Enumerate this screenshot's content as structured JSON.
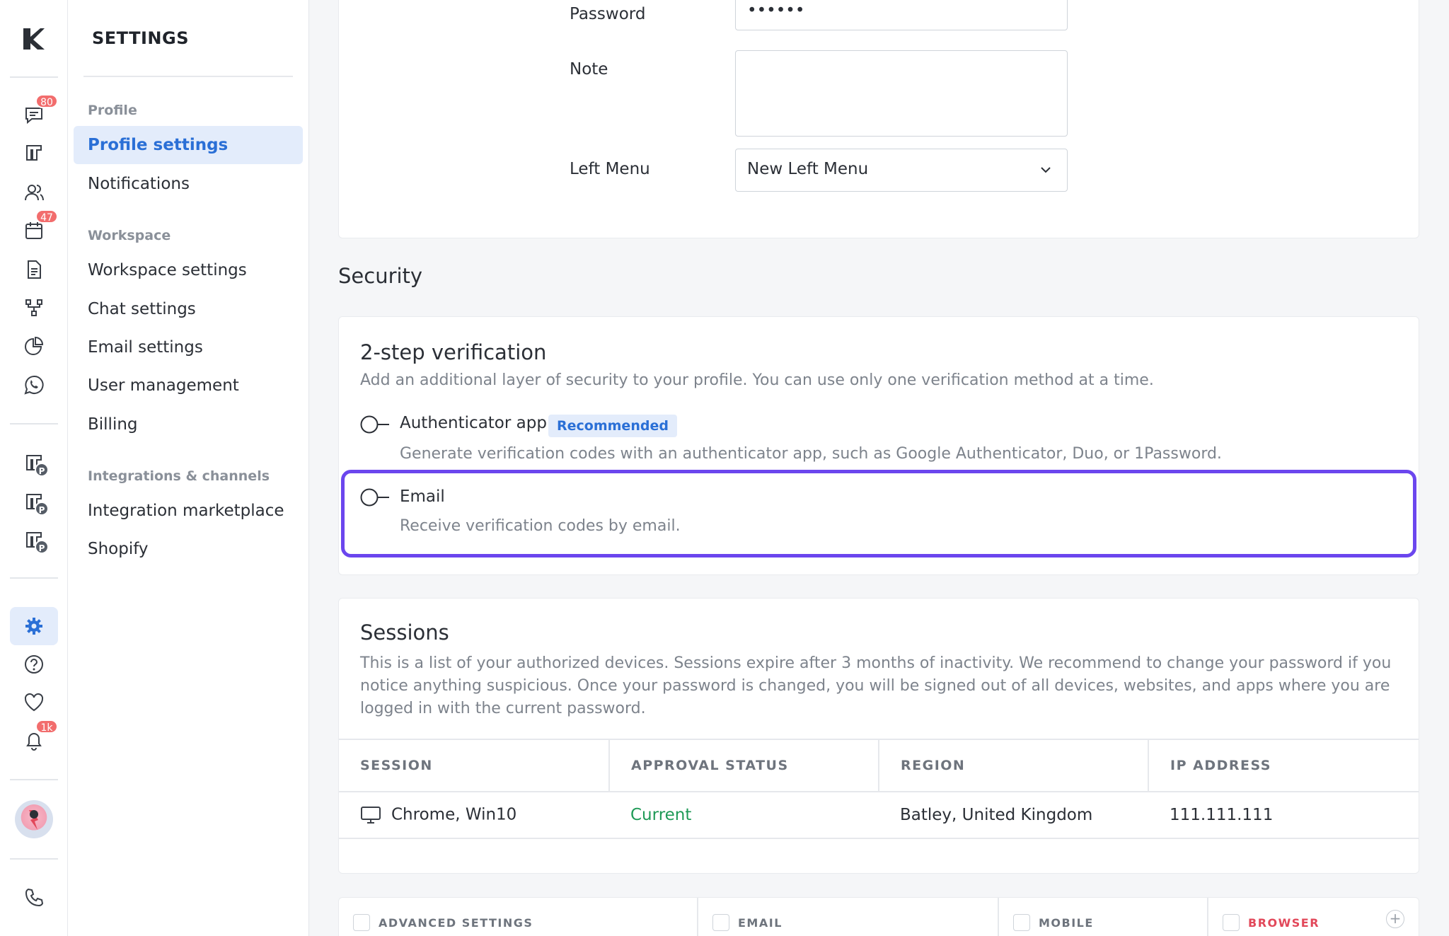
{
  "rail": {
    "badges": {
      "chats": "80",
      "calendar": "47",
      "notifications": "1k"
    },
    "pipeline_badge": "P"
  },
  "menu": {
    "title": "SETTINGS",
    "sections": [
      {
        "label": "Profile",
        "items": [
          {
            "label": "Profile settings"
          },
          {
            "label": "Notifications"
          }
        ]
      },
      {
        "label": "Workspace",
        "items": [
          {
            "label": "Workspace settings"
          },
          {
            "label": "Chat settings"
          },
          {
            "label": "Email settings"
          },
          {
            "label": "User management"
          },
          {
            "label": "Billing"
          }
        ]
      },
      {
        "label": "Integrations & channels",
        "items": [
          {
            "label": "Integration marketplace"
          },
          {
            "label": "Shopify"
          }
        ]
      }
    ]
  },
  "profile_form": {
    "password_label": "Password",
    "password_value": "••••••",
    "note_label": "Note",
    "note_value": "",
    "left_menu_label": "Left Menu",
    "left_menu_value": "New Left Menu"
  },
  "security": {
    "heading": "Security",
    "two_step": {
      "title": "2-step verification",
      "description": "Add an additional layer of security to your profile. You can use only one verification method at a time.",
      "options": [
        {
          "label": "Authenticator app",
          "badge": "Recommended",
          "description": "Generate verification codes with an authenticator app, such as Google Authenticator, Duo, or 1Password."
        },
        {
          "label": "Email",
          "description": "Receive verification codes by email."
        }
      ]
    },
    "sessions": {
      "title": "Sessions",
      "description": "This is a list of your authorized devices. Sessions expire after 3 months of inactivity. We recommend to change your password if you notice anything suspicious. Once your password is changed, you will be signed out of all devices, websites, and apps where you are logged in with the current password.",
      "columns": [
        "SESSION",
        "APPROVAL STATUS",
        "REGION",
        "IP ADDRESS"
      ],
      "rows": [
        {
          "session": "Chrome, Win10",
          "status": "Current",
          "region": "Batley, United Kingdom",
          "ip": "111.111.111"
        }
      ]
    }
  },
  "advanced": {
    "columns": [
      "ADVANCED SETTINGS",
      "EMAIL",
      "MOBILE",
      "BROWSER"
    ],
    "add": "+"
  },
  "colors": {
    "accent": "#2a6fd6",
    "highlight": "#6b46ee",
    "badge": "#f26d6d",
    "success": "#1f9a57"
  }
}
